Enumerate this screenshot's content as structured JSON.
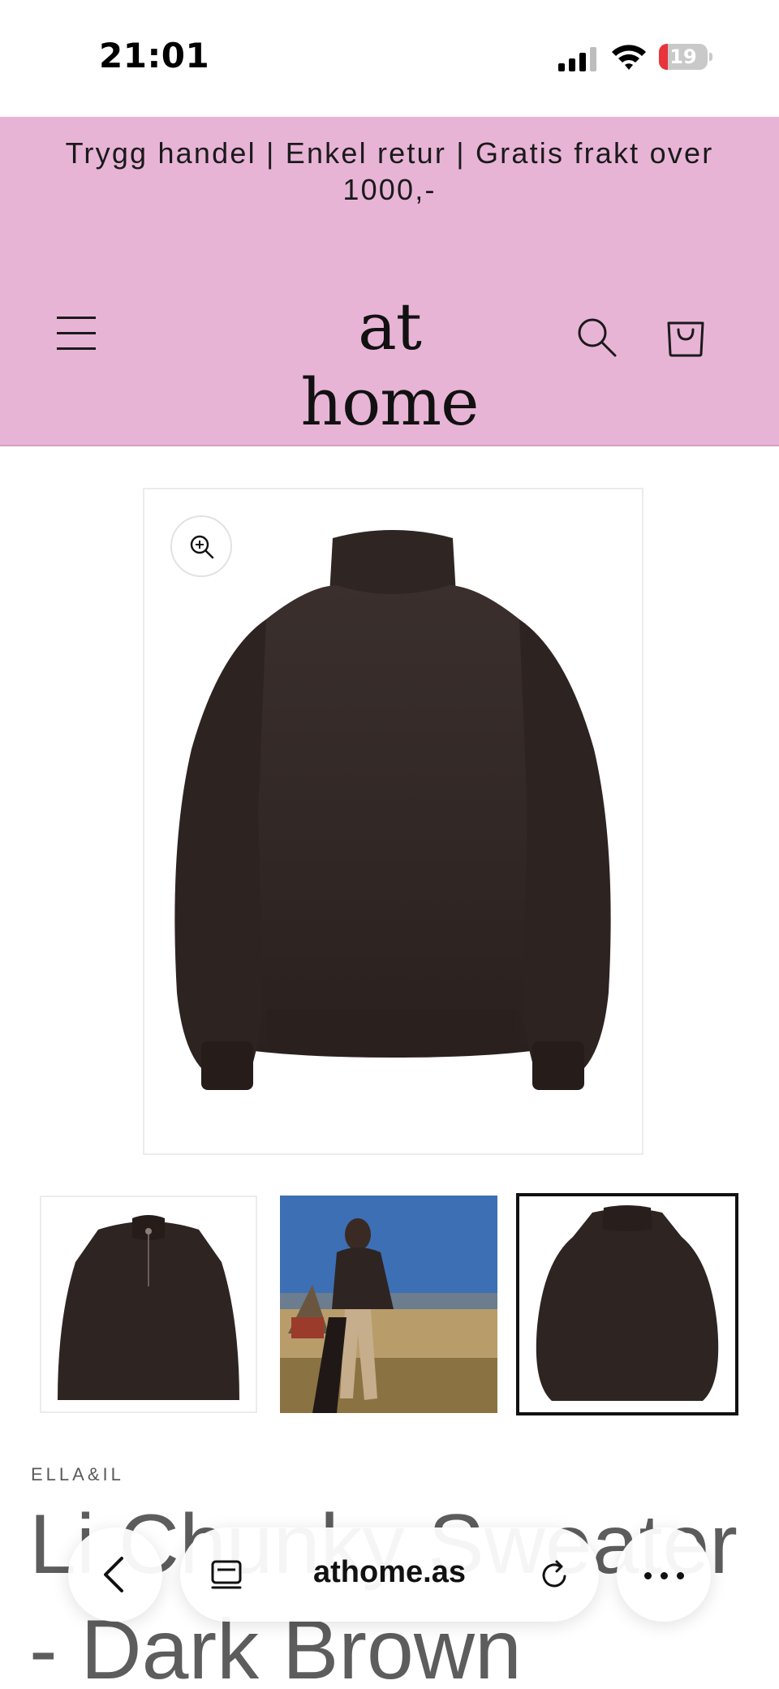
{
  "status_bar": {
    "time": "21:01",
    "battery_level": "19",
    "battery_fraction": 0.19
  },
  "announcement": {
    "text": "Trygg handel | Enkel retur | Gratis frakt over 1000,-"
  },
  "header": {
    "logo_text": "at home",
    "menu_icon": "hamburger-menu-icon",
    "search_icon": "search-icon",
    "cart_icon": "cart-icon",
    "background_color": "#e8b4d6"
  },
  "product": {
    "zoom_icon": "zoom-in-icon",
    "vendor": "ELLA&IL",
    "title": "Li Chunky Sweater - Dark Brown",
    "selected_thumbnail": 3,
    "sweater_color": "#2e2422"
  },
  "browser": {
    "url": "athome.as",
    "back_icon": "chevron-left-icon",
    "tabs_icon": "tabs-icon",
    "reload_icon": "reload-icon",
    "more_icon": "more-icon"
  }
}
